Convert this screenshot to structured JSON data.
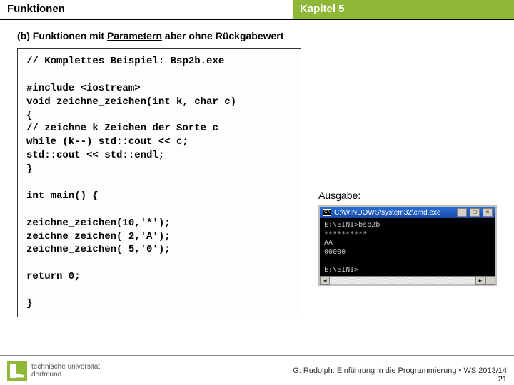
{
  "header": {
    "left": "Funktionen",
    "right": "Kapitel 5"
  },
  "subtitle": {
    "prefix": "(b) Funktionen mit ",
    "underlined": "Parametern",
    "suffix": " aber ohne Rückgabewert"
  },
  "code": {
    "l1": "// Komplettes Beispiel: Bsp2b.exe",
    "l2": "#include <iostream>",
    "l3": "void zeichne_zeichen(int k, char c)",
    "l4": "{",
    "l5": "  // zeichne k Zeichen der Sorte c",
    "l6": "  while (k--) std::cout << c;",
    "l7": "  std::cout << std::endl;",
    "l8": "}",
    "l9": "int main() {",
    "l10": "  zeichne_zeichen(10,'*');",
    "l11": "  zeichne_zeichen( 2,'A');",
    "l12": "  zeichne_zeichen( 5,'0');",
    "l13": "  return 0;",
    "l14": "}"
  },
  "output": {
    "label": "Ausgabe:",
    "window_title": "C:\\WINDOWS\\system32\\cmd.exe",
    "body": "E:\\EINI>bsp2b\n**********\nAA\n00000\n\nE:\\EINI>"
  },
  "footer": {
    "uni1": "technische universität",
    "uni2": "dortmund",
    "credit": "G. Rudolph: Einführung in die Programmierung ▪ WS 2013/14",
    "page": "21"
  },
  "buttons": {
    "min": "_",
    "max": "□",
    "close": "×",
    "left": "◄",
    "right": "►"
  }
}
